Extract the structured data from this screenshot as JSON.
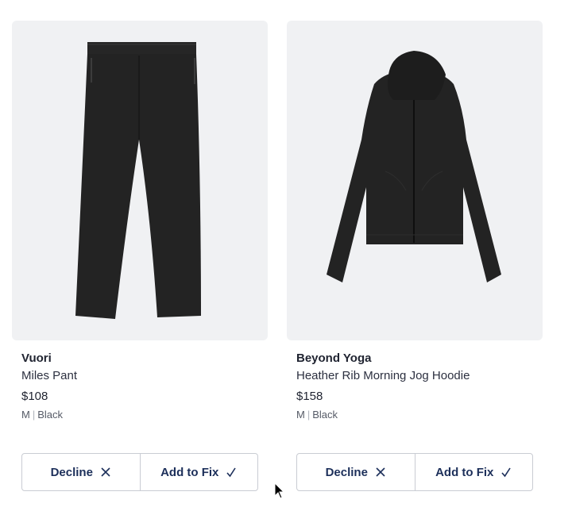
{
  "products": [
    {
      "brand": "Vuori",
      "name": "Miles Pant",
      "price": "$108",
      "size": "M",
      "color": "Black",
      "image_icon": "pants-image",
      "decline_label": "Decline",
      "add_label": "Add to Fix"
    },
    {
      "brand": "Beyond Yoga",
      "name": "Heather Rib Morning Jog Hoodie",
      "price": "$158",
      "size": "M",
      "color": "Black",
      "image_icon": "hoodie-image",
      "decline_label": "Decline",
      "add_label": "Add to Fix"
    }
  ],
  "colors": {
    "accent": "#1c2f5a",
    "image_bg": "#f0f1f3",
    "border": "#c9ccd3"
  }
}
